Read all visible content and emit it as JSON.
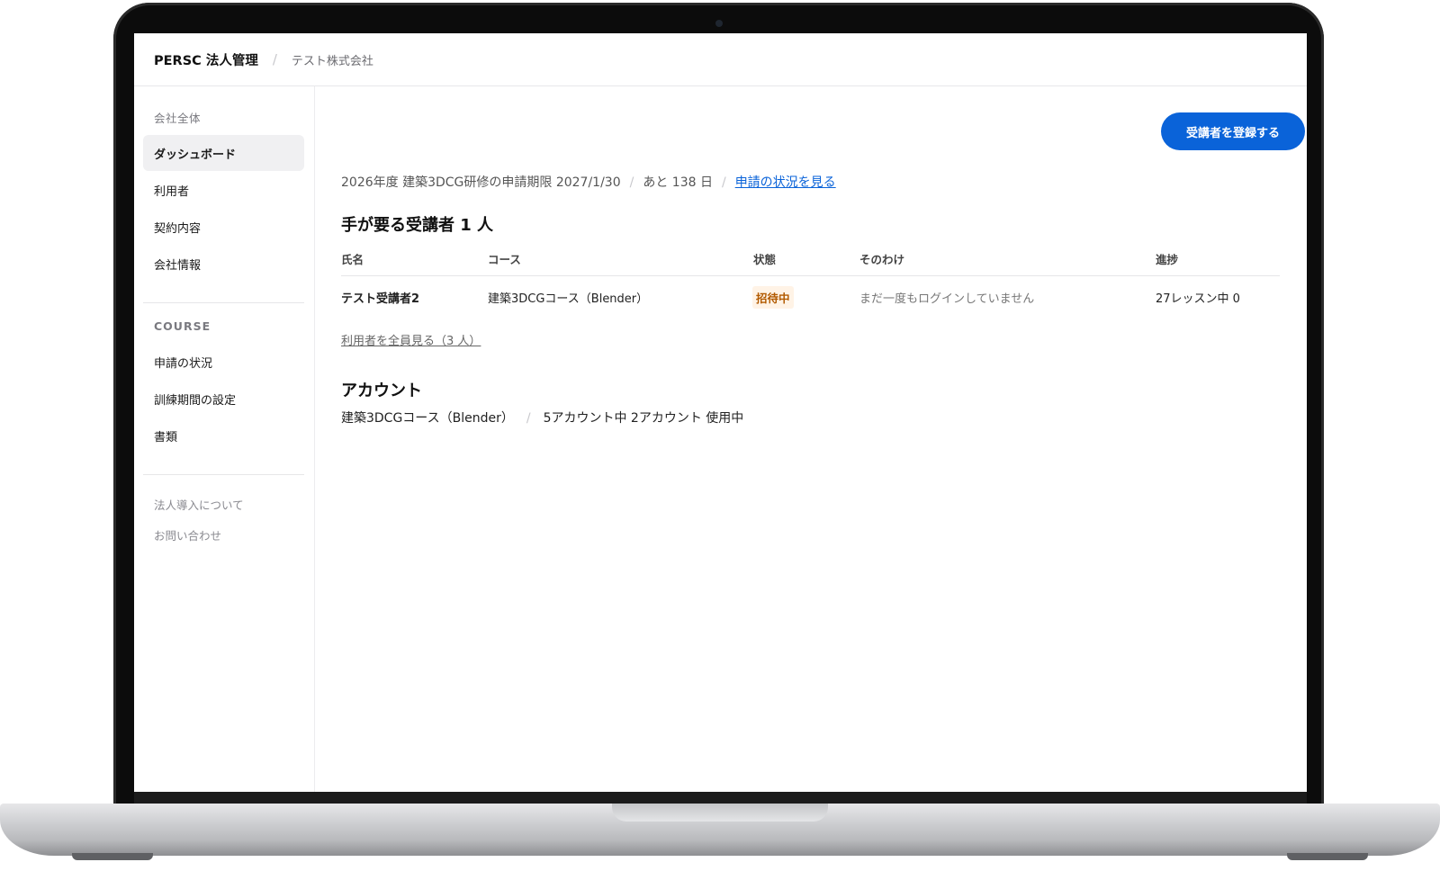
{
  "app": {
    "brand": "PERSC 法人管理",
    "crumb_separator": "/",
    "company": "テスト株式会社"
  },
  "sidebar": {
    "group_company": "会社全体",
    "items": [
      {
        "label": "ダッシュボード",
        "active": true
      },
      {
        "label": "利用者"
      },
      {
        "label": "契約内容"
      },
      {
        "label": "会社情報"
      }
    ],
    "group_course": "COURSE",
    "course_items": [
      {
        "label": "申請の状況"
      },
      {
        "label": "訓練期間の設定"
      },
      {
        "label": "書類"
      }
    ],
    "sub_links": [
      {
        "label": "法人導入について"
      },
      {
        "label": "お問い合わせ"
      }
    ]
  },
  "main": {
    "register_button": "受講者を登録する",
    "period": {
      "text": "2026年度 建築3DCG研修の申請期限 2027/1/30",
      "separator": "/",
      "remaining": "あと 138 日",
      "link": "申請の状況を見る"
    },
    "need_heading": "手が要る受講者 1 人",
    "table": {
      "headers": [
        "氏名",
        "コース",
        "状態",
        "そのわけ",
        "進捗"
      ],
      "rows": [
        {
          "name": "テスト受講者2",
          "course": "建築3DCGコース（Blender）",
          "status": "招待中",
          "reason": "まだ一度もログインしていません",
          "progress": "27レッスン中 0"
        }
      ]
    },
    "see_all": "利用者を全員見る（3 人）",
    "account_heading": "アカウント",
    "account": {
      "course": "建築3DCGコース（Blender）",
      "separator": "/",
      "usage": "5アカウント中 2アカウント 使用中"
    }
  },
  "colors": {
    "accent": "#0a63d9",
    "status_badge_bg": "#fff3e6",
    "status_badge_text": "#b25a00"
  }
}
